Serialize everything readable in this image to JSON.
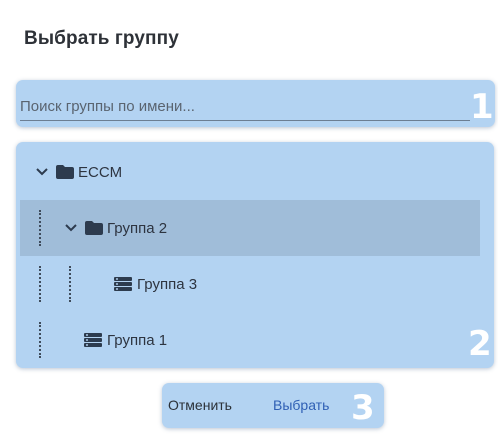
{
  "dialog": {
    "title": "Выбрать группу"
  },
  "search": {
    "placeholder": "Поиск группы по имени...",
    "value": "",
    "callout_number": "1"
  },
  "tree": {
    "callout_number": "2",
    "nodes": [
      {
        "label": "ECCM",
        "type": "folder",
        "expanded": true,
        "depth": 0,
        "selected": false
      },
      {
        "label": "Группа 2",
        "type": "folder",
        "expanded": true,
        "depth": 1,
        "selected": true
      },
      {
        "label": "Группа 3",
        "type": "group",
        "depth": 2,
        "selected": false
      },
      {
        "label": "Группа 1",
        "type": "group",
        "depth": 1,
        "selected": false
      }
    ]
  },
  "actions": {
    "cancel_label": "Отменить",
    "select_label": "Выбрать",
    "callout_number": "3"
  },
  "icons": {
    "folder": "folder-icon",
    "group": "server-stack-icon",
    "expand": "chevron-down-icon"
  },
  "colors": {
    "callout_background": "#b3d3f2",
    "selected_row": "#a0bdd9",
    "primary_button_text": "#2f5fb4",
    "icon": "#2d3b4e"
  }
}
